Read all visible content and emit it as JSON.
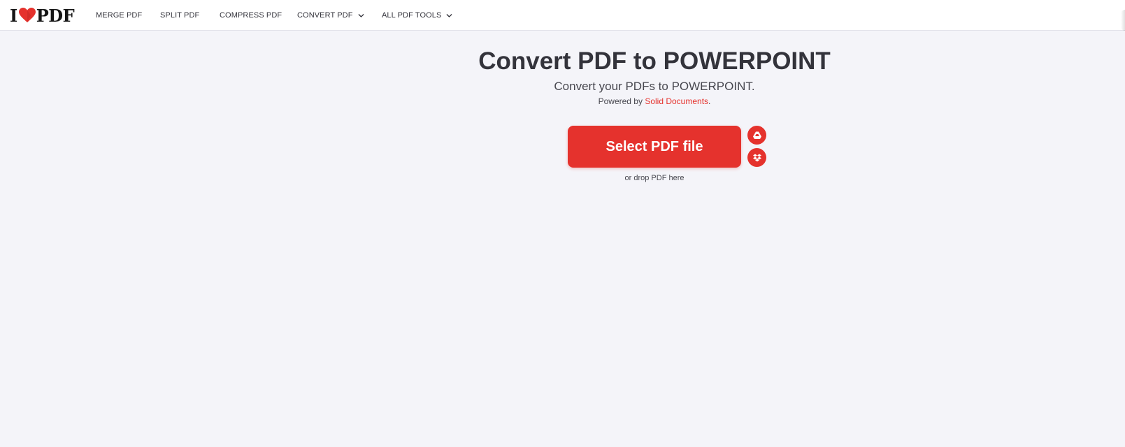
{
  "header": {
    "logo_left": "I",
    "logo_right": "PDF",
    "nav": [
      {
        "label": "MERGE PDF",
        "dropdown": false
      },
      {
        "label": "SPLIT PDF",
        "dropdown": false
      },
      {
        "label": "COMPRESS PDF",
        "dropdown": false
      },
      {
        "label": "CONVERT PDF",
        "dropdown": true
      },
      {
        "label": "ALL PDF TOOLS",
        "dropdown": true
      }
    ]
  },
  "main": {
    "title": "Convert PDF to POWERPOINT",
    "subtitle": "Convert your PDFs to POWERPOINT.",
    "powered_prefix": "Powered by ",
    "powered_link": "Solid Documents",
    "powered_suffix": ".",
    "select_button": "Select PDF file",
    "drop_hint": "or drop PDF here",
    "cloud_buttons": [
      {
        "icon": "google-drive-icon"
      },
      {
        "icon": "dropbox-icon"
      }
    ]
  },
  "colors": {
    "brand_red": "#e5322d",
    "background": "#f4f4f9",
    "text": "#33333b"
  }
}
